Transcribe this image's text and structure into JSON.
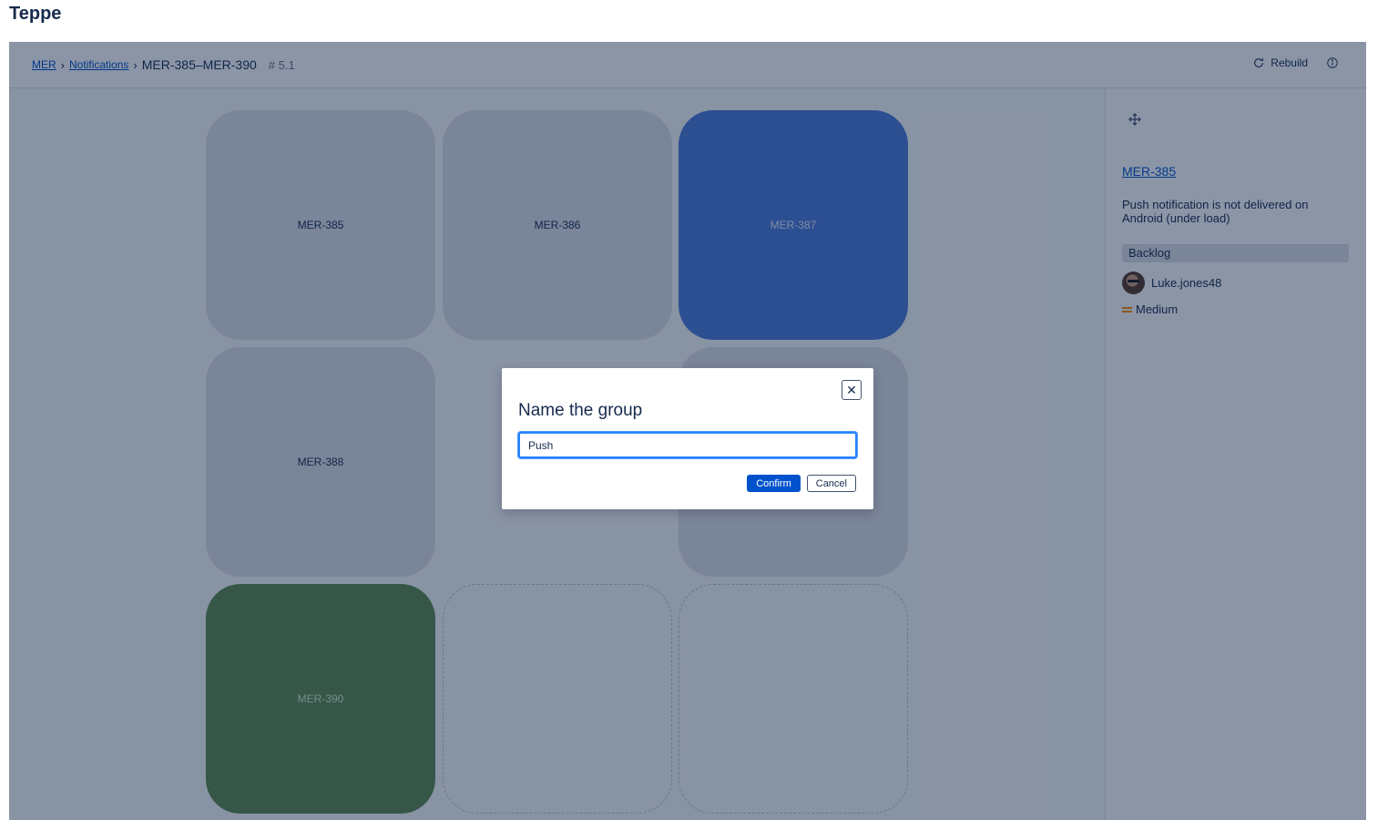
{
  "app": {
    "title": "Teppe"
  },
  "breadcrumb": {
    "project": "MER",
    "section": "Notifications",
    "current": "MER-385–MER-390",
    "version": "# 5.1"
  },
  "toolbar": {
    "rebuild_label": "Rebuild",
    "rebuild_icon": "refresh-icon",
    "info_icon": "info-icon"
  },
  "grid": {
    "tiles": [
      {
        "label": "MER-385",
        "state": "grey"
      },
      {
        "label": "MER-386",
        "state": "grey"
      },
      {
        "label": "MER-387",
        "state": "selected-blue"
      },
      {
        "label": "MER-388",
        "state": "grey"
      },
      {
        "label": "",
        "state": "hidden-under-dialog"
      },
      {
        "label": "",
        "state": "grey"
      },
      {
        "label": "MER-390",
        "state": "green"
      },
      {
        "label": "",
        "state": "empty-slot"
      },
      {
        "label": "",
        "state": "empty-slot"
      }
    ]
  },
  "side_panel": {
    "move_icon": "move-icon",
    "issue_key": "MER-385",
    "summary": "Push notification is not delivered on Android (under load)",
    "status": "Backlog",
    "assignee": "Luke.jones48",
    "priority": "Medium",
    "priority_color": "#ff8b00"
  },
  "dialog": {
    "title": "Name the group",
    "input_value": "Push",
    "confirm_label": "Confirm",
    "cancel_label": "Cancel",
    "close_glyph": "✕"
  },
  "colors": {
    "accent": "#0052cc",
    "selected_tile": "#4c7bd9",
    "green_tile": "#5f8b4c",
    "grey_tile": "#dfe1e6"
  }
}
